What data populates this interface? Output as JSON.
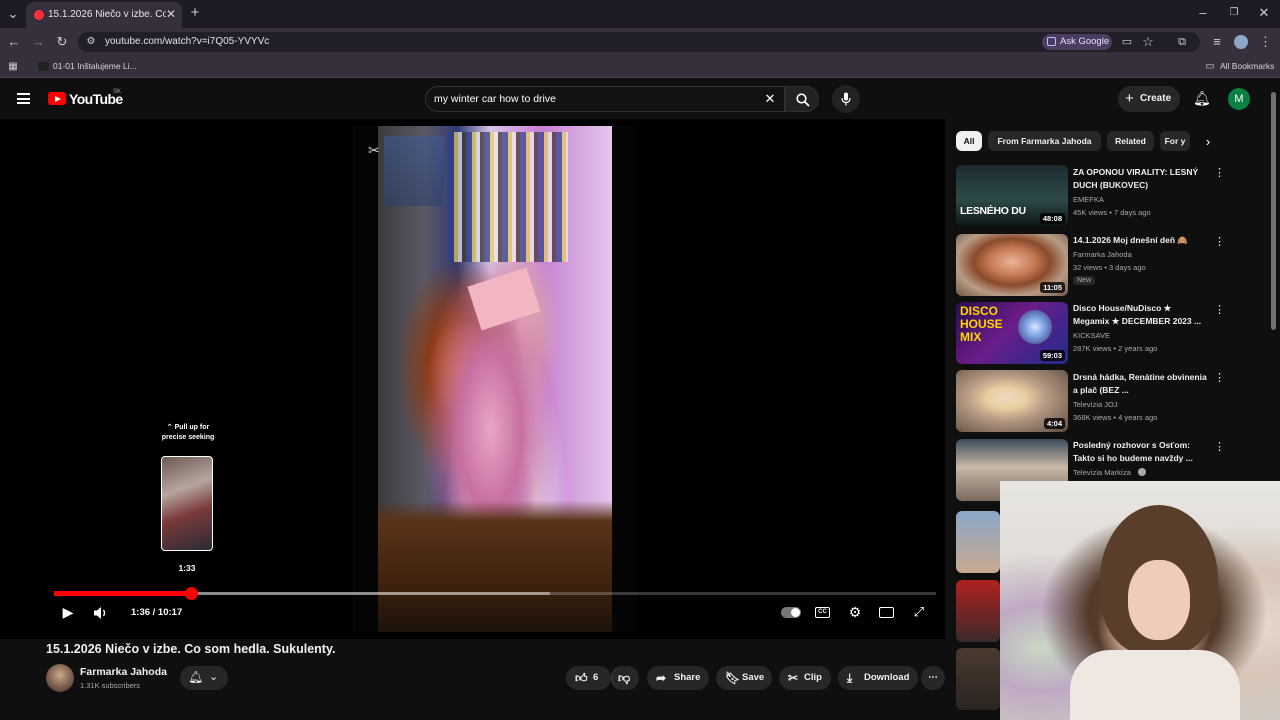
{
  "browser": {
    "tab_title": "15.1.2026 Niečo v izbe. Co s",
    "url": "youtube.com/watch?v=i7Q05-YVYVc",
    "ask_google": "Ask Google",
    "bookmark_1": "01-01 Inštalujeme Li...",
    "all_bookmarks": "All Bookmarks"
  },
  "header": {
    "logo": "YouTube",
    "country": "SK",
    "search_query": "my winter car how to drive",
    "create_label": "Create",
    "avatar_letter": "M"
  },
  "player": {
    "pull_up_hint": "Pull up for precise seeking",
    "preview_time": "1:33",
    "time_display": "1:36 / 10:17",
    "progress": 0.155,
    "buffered": 0.562
  },
  "video": {
    "title": "15.1.2026 Niečo v izbe. Co som hedla. Sukulenty.",
    "channel": "Farmarka Jahoda",
    "subscribers": "1.31K subscribers",
    "likes": "6",
    "share": "Share",
    "save": "Save",
    "clip": "Clip",
    "download": "Download"
  },
  "sidebar": {
    "chips": [
      "All",
      "From Farmarka Jahoda",
      "Related",
      "For y"
    ],
    "items": [
      {
        "title": "ZA OPONOU VIRALITY: LESNÝ DUCH (BUKOVEC)",
        "channel": "EMEFKA",
        "meta": "45K views • 7 days ago",
        "duration": "48:08",
        "thumb_text": "LESNÉHO DU"
      },
      {
        "title": "14.1.2026 Moj dnešní deň 🙈",
        "channel": "Farmarka Jahoda",
        "meta": "32 views • 3 days ago",
        "duration": "11:05",
        "badge": "New"
      },
      {
        "title": "Disco House/NuDisco ★ Megamix ★ DECEMBER 2023 ...",
        "channel": "KICKSAVE",
        "meta": "287K views • 2 years ago",
        "duration": "59:03",
        "thumb_text": "DISCO HOUSE MIX"
      },
      {
        "title": "Drsná hádka, Renátine obvinenia a plač (BEZ ...",
        "channel": "Televízia JOJ",
        "meta": "368K views • 4 years ago",
        "duration": "4:04"
      },
      {
        "title": "Posledný rozhovor s Osťom: Takto si ho budeme navždy ...",
        "channel": "Televízia Markíza",
        "meta": "",
        "duration": ""
      }
    ]
  }
}
